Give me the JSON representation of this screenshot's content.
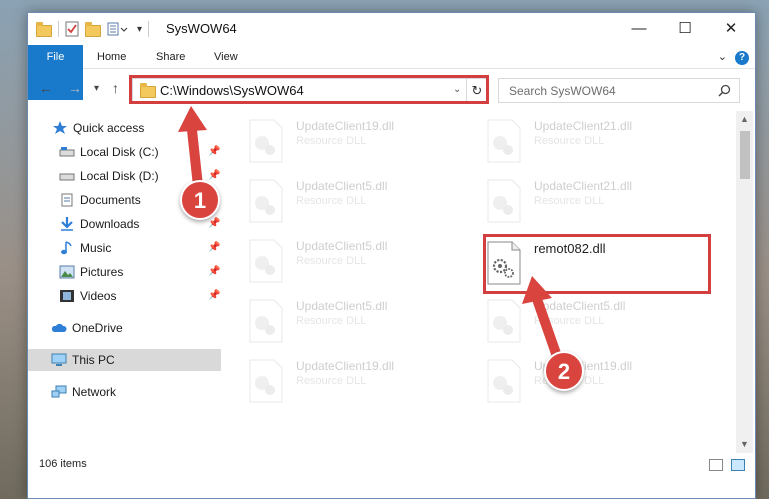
{
  "window": {
    "title": "SysWOW64",
    "controls": {
      "minimize": "—",
      "maximize": "☐",
      "close": "✕"
    }
  },
  "ribbon": {
    "tabs": [
      {
        "label": "File"
      },
      {
        "label": "Home"
      },
      {
        "label": "Share"
      },
      {
        "label": "View"
      }
    ],
    "help": "?"
  },
  "navigation": {
    "address": "C:\\Windows\\SysWOW64",
    "search_placeholder": "Search SysWOW64"
  },
  "sidebar": {
    "items": [
      {
        "label": "Quick access",
        "icon": "star-icon"
      },
      {
        "label": "Local Disk (C:)",
        "icon": "drive-icon",
        "pinned": true
      },
      {
        "label": "Local Disk (D:)",
        "icon": "drive-icon",
        "pinned": true
      },
      {
        "label": "Documents",
        "icon": "documents-icon",
        "pinned": true
      },
      {
        "label": "Downloads",
        "icon": "download-icon",
        "pinned": true
      },
      {
        "label": "Music",
        "icon": "music-icon",
        "pinned": true
      },
      {
        "label": "Pictures",
        "icon": "pictures-icon",
        "pinned": true
      },
      {
        "label": "Videos",
        "icon": "videos-icon",
        "pinned": true
      },
      {
        "label": "OneDrive",
        "icon": "cloud-icon"
      },
      {
        "label": "This PC",
        "icon": "computer-icon",
        "selected": true
      },
      {
        "label": "Network",
        "icon": "network-icon"
      }
    ]
  },
  "files": [
    {
      "name": "UpdateClient19.dll",
      "type": "Resource DLL",
      "faded": true
    },
    {
      "name": "UpdateClient21.dll",
      "type": "Resource DLL",
      "faded": true
    },
    {
      "name": "UpdateClient5.dll",
      "type": "Resource DLL",
      "faded": true
    },
    {
      "name": "UpdateClient21.dll",
      "type": "Resource DLL",
      "faded": true
    },
    {
      "name": "UpdateClient5.dll",
      "type": "Resource DLL",
      "faded": true
    },
    {
      "name": "remot082.dll",
      "type": "",
      "faded": false
    },
    {
      "name": "UpdateClient5.dll",
      "type": "Resource DLL",
      "faded": true
    },
    {
      "name": "UpdateClient5.dll",
      "type": "Resource DLL",
      "faded": true
    },
    {
      "name": "UpdateClient19.dll",
      "type": "Resource DLL",
      "faded": true
    },
    {
      "name": "UpdateClient19.dll",
      "type": "Resource DLL",
      "faded": true
    }
  ],
  "status": {
    "item_count": "106 items"
  },
  "annotations": {
    "step1": "1",
    "step2": "2"
  },
  "colors": {
    "accent": "#1979ca",
    "highlight": "#d33f3f",
    "badge": "#d9443f"
  }
}
